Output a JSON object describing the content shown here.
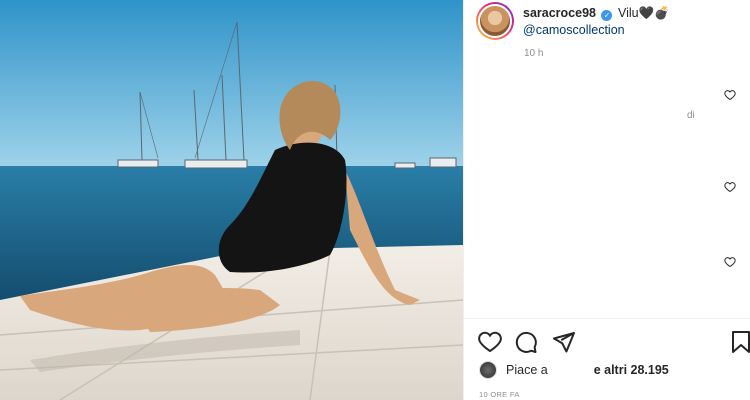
{
  "post": {
    "username": "saracroce98",
    "caption_text": "Vilu🖤💣",
    "mention": "@camoscollection",
    "time_ago": "10 h",
    "comment_fragment": "di"
  },
  "likes": {
    "prefix": "Piace a",
    "suffix": "e altri 28.195"
  },
  "post_date": "10 ORE FA",
  "icons": {
    "verified": "verified-badge-icon",
    "like": "heart-icon",
    "comment": "comment-icon",
    "share": "send-icon",
    "save": "bookmark-icon"
  },
  "colors": {
    "verified": "#3897f0",
    "mention": "#00376b",
    "secondary_text": "#8e8e8e",
    "sky": "#4aa8d8",
    "sea": "#1d5f84"
  }
}
